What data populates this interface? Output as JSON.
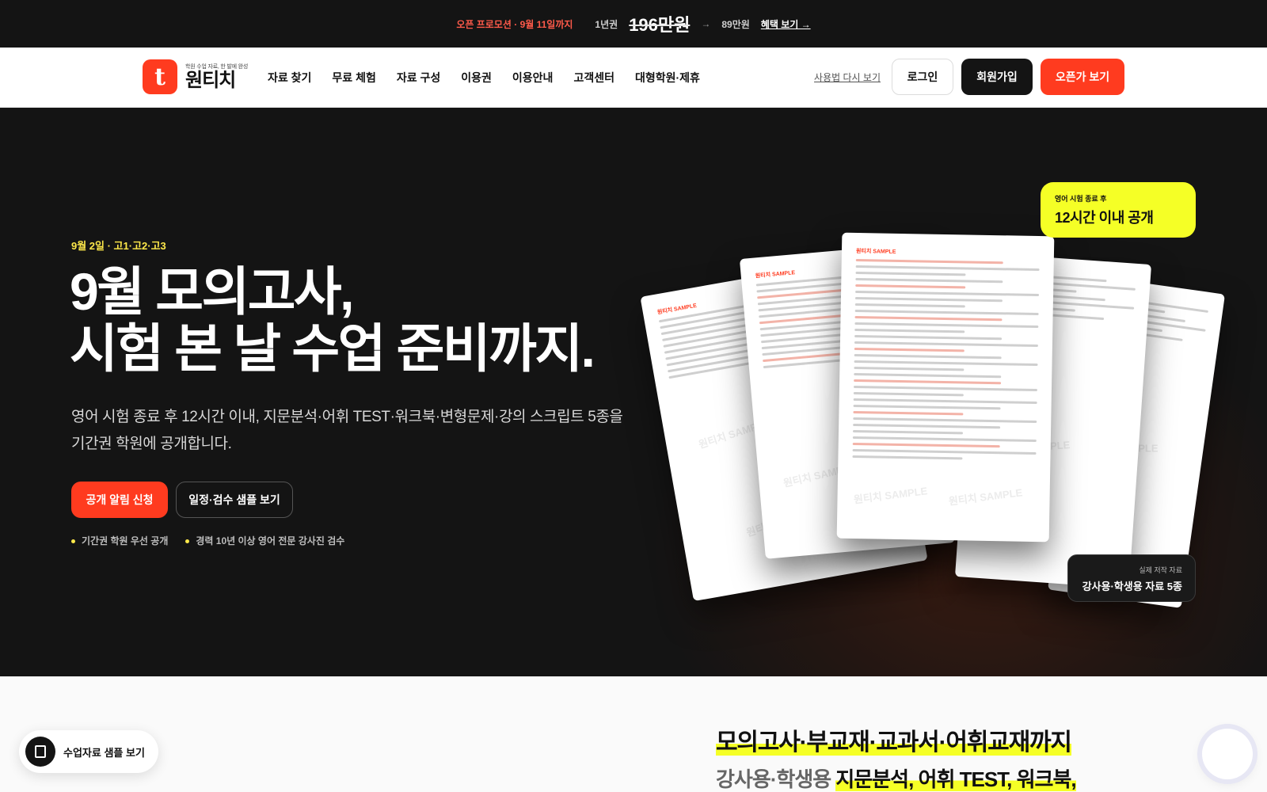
{
  "promo": {
    "text": "오픈 프로모션 · 9월 11일까지",
    "year_label": "1년권",
    "old_price": "196만원",
    "new_price": "89만원",
    "link": "혜택 보기 →"
  },
  "nav": {
    "logo_tagline": "학원 수업 자료, 한 발에 완성",
    "logo_name": "원티치",
    "logo_letter": "t",
    "menu": [
      "자료 찾기",
      "무료 체험",
      "자료 구성",
      "이용권",
      "이용안내",
      "고객센터",
      "대형학원·제휴"
    ],
    "howto": "사용법 다시 보기",
    "login": "로그인",
    "signup": "회원가입",
    "open_price": "오픈가 보기"
  },
  "hero": {
    "eyebrow": "9월 2일 · 고1·고2·고3",
    "title_line1": "9월 모의고사,",
    "title_line2": "시험 본 날 수업 준비까지.",
    "desc_line1": "영어 시험 종료 후 12시간 이내, 지문분석·어휘 TEST·워크북·변형문제·강의 스크립트 5종을",
    "desc_line2": "기간권 학원에 공개합니다.",
    "cta_primary": "공개 알림 신청",
    "cta_secondary": "일정·검수 샘플 보기",
    "bullets": [
      "기간권 학원 우선 공개",
      "경력 10년 이상 영어 전문 강사진 검수"
    ],
    "badge_top_small": "영어 시험 종료 후",
    "badge_top_big": "12시간 이내 공개",
    "badge_bottom_small": "실제 저작 자료",
    "badge_bottom_big": "강사용·학생용 자료 5종",
    "doc_header": "원티치 SAMPLE",
    "watermark": "원티치 SAMPLE"
  },
  "section2": {
    "title": "모의고사·부교재·교과서·어휘교재까지",
    "sub_plain": "강사용·학생용 ",
    "sub_strong": "지문분석, 어휘 TEST, 워크북,"
  },
  "floating": {
    "sample_label": "수업자료 샘플 보기"
  },
  "colors": {
    "accent": "#ff3b1f",
    "highlight": "#f5ff26",
    "dark": "#141414"
  }
}
